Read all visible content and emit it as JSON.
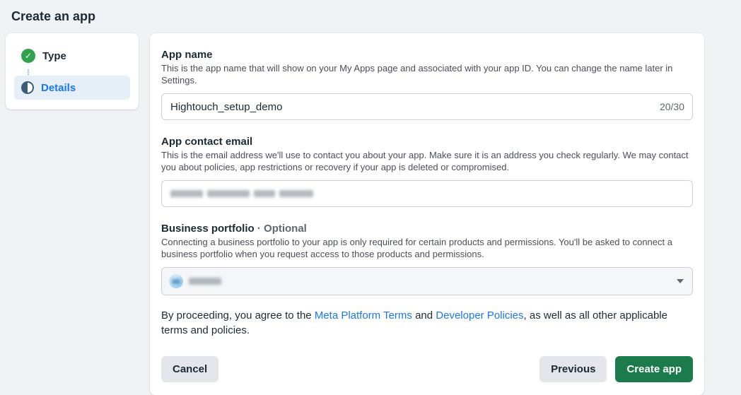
{
  "page": {
    "title": "Create an app"
  },
  "stepper": {
    "steps": [
      {
        "label": "Type",
        "state": "complete"
      },
      {
        "label": "Details",
        "state": "current"
      }
    ]
  },
  "form": {
    "app_name": {
      "label": "App name",
      "description": "This is the app name that will show on your My Apps page and associated with your app ID. You can change the name later in Settings.",
      "value": "Hightouch_setup_demo",
      "counter": "20/30"
    },
    "contact_email": {
      "label": "App contact email",
      "description": "This is the email address we'll use to contact you about your app. Make sure it is an address you check regularly. We may contact you about policies, app restrictions or recovery if your app is deleted or compromised.",
      "value_redacted": true
    },
    "business_portfolio": {
      "label": "Business portfolio",
      "optional": "· Optional",
      "description": "Connecting a business portfolio to your app is only required for certain products and permissions. You'll be asked to connect a business portfolio when you request access to those products and permissions.",
      "value_redacted": true
    },
    "legal": {
      "prefix": "By proceeding, you agree to the ",
      "link1": "Meta Platform Terms",
      "middle": " and ",
      "link2": "Developer Policies",
      "suffix": ", as well as all other applicable terms and policies."
    },
    "buttons": {
      "cancel": "Cancel",
      "previous": "Previous",
      "create": "Create app"
    }
  },
  "icons": {
    "step_complete": "check-circle-icon",
    "step_current": "half-circle-progress-icon",
    "select_caret": "chevron-down-icon",
    "check_glyph": "✓"
  },
  "colors": {
    "page_background": "#f0f2f5",
    "link_blue": "#1877f2",
    "success_green": "#31a24c",
    "create_button_green": "#1c7b4c",
    "current_step_highlight": "#e6eef8"
  }
}
